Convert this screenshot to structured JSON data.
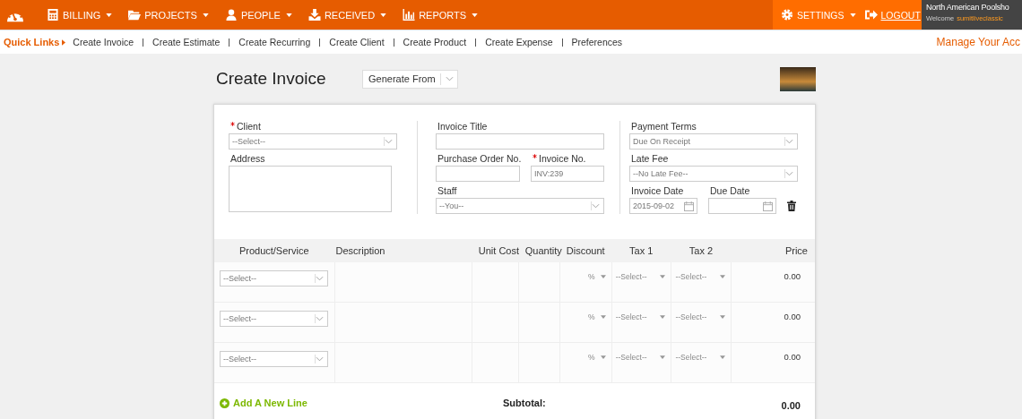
{
  "nav": {
    "items": [
      {
        "label": "BILLING"
      },
      {
        "label": "PROJECTS"
      },
      {
        "label": "PEOPLE"
      },
      {
        "label": "RECEIVED"
      },
      {
        "label": "REPORTS"
      }
    ],
    "settings": "SETTINGS",
    "logout": "LOGOUT"
  },
  "user": {
    "company": "North American Poolsho",
    "welcome": "Welcome",
    "username": "sumitliveclassic"
  },
  "quick_links": {
    "title": "Quick Links",
    "items": [
      "Create Invoice",
      "Create Estimate",
      "Create Recurring",
      "Create Client",
      "Create Product",
      "Create Expense",
      "Preferences"
    ],
    "manage": "Manage Your Acc"
  },
  "page": {
    "title": "Create Invoice",
    "generate_from": "Generate From"
  },
  "form": {
    "columns": [
      [
        [
          {
            "kind": "select",
            "label": "Client",
            "required": true,
            "value": "--Select--"
          }
        ],
        [
          {
            "kind": "textarea",
            "label": "Address",
            "required": false
          }
        ]
      ],
      [
        [
          {
            "kind": "text",
            "label": "Invoice Title",
            "required": false
          }
        ],
        [
          {
            "kind": "text",
            "label": "Purchase Order No.",
            "required": false
          },
          {
            "kind": "text",
            "label": "Invoice No.",
            "required": true,
            "value": "INV:239"
          }
        ],
        [
          {
            "kind": "select",
            "label": "Staff",
            "required": false,
            "value": "--You--"
          }
        ]
      ],
      [
        [
          {
            "kind": "select",
            "label": "Payment Terms",
            "required": false,
            "value": "Due On Receipt"
          }
        ],
        [
          {
            "kind": "select",
            "label": "Late Fee",
            "required": false,
            "value": "--No Late Fee--"
          }
        ],
        [
          {
            "kind": "date",
            "label": "Invoice Date",
            "required": false,
            "value": "2015-09-02"
          },
          {
            "kind": "date",
            "label": "Due Date",
            "required": false
          },
          {
            "kind": "delete"
          }
        ]
      ]
    ]
  },
  "table": {
    "columns": [
      "Product/Service",
      "Description",
      "Unit Cost",
      "Quantity",
      "Discount",
      "Tax 1",
      "Tax 2",
      "Price"
    ],
    "rows": [
      {
        "product": "--Select--",
        "discount": "%",
        "tax1": "--Select--",
        "tax2": "--Select--",
        "price": "0.00"
      },
      {
        "product": "--Select--",
        "discount": "%",
        "tax1": "--Select--",
        "tax2": "--Select--",
        "price": "0.00"
      },
      {
        "product": "--Select--",
        "discount": "%",
        "tax1": "--Select--",
        "tax2": "--Select--",
        "price": "0.00"
      }
    ]
  },
  "footer": {
    "add_line": "Add A New Line",
    "subtotal_label": "Subtotal:",
    "subtotal": "0.00"
  }
}
